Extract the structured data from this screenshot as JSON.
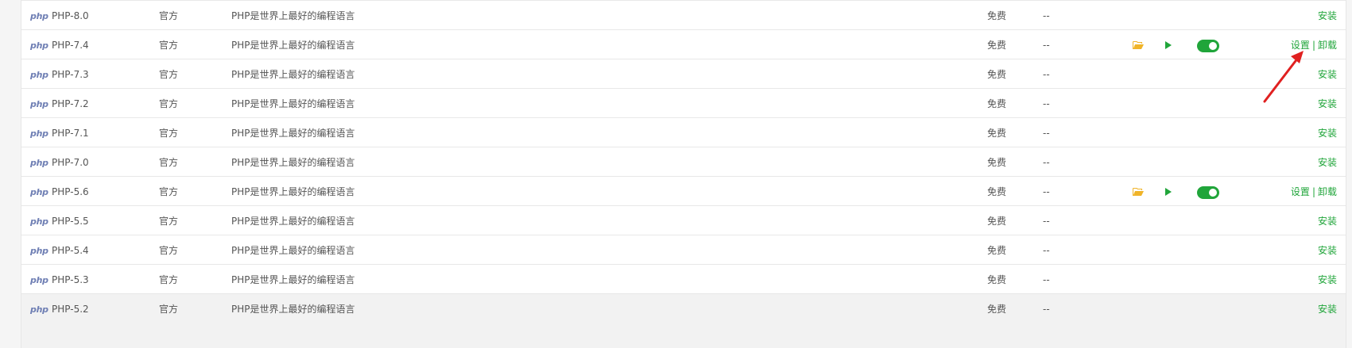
{
  "rows": [
    {
      "logo": "php",
      "name": "PHP-8.0",
      "type": "官方",
      "desc": "PHP是世界上最好的编程语言",
      "price": "免费",
      "expire": "--",
      "installed": false,
      "op_install": "安装"
    },
    {
      "logo": "php",
      "name": "PHP-7.4",
      "type": "官方",
      "desc": "PHP是世界上最好的编程语言",
      "price": "免费",
      "expire": "--",
      "installed": true,
      "op_settings": "设置",
      "op_sep": "|",
      "op_uninstall": "卸载"
    },
    {
      "logo": "php",
      "name": "PHP-7.3",
      "type": "官方",
      "desc": "PHP是世界上最好的编程语言",
      "price": "免费",
      "expire": "--",
      "installed": false,
      "op_install": "安装"
    },
    {
      "logo": "php",
      "name": "PHP-7.2",
      "type": "官方",
      "desc": "PHP是世界上最好的编程语言",
      "price": "免费",
      "expire": "--",
      "installed": false,
      "op_install": "安装"
    },
    {
      "logo": "php",
      "name": "PHP-7.1",
      "type": "官方",
      "desc": "PHP是世界上最好的编程语言",
      "price": "免费",
      "expire": "--",
      "installed": false,
      "op_install": "安装"
    },
    {
      "logo": "php",
      "name": "PHP-7.0",
      "type": "官方",
      "desc": "PHP是世界上最好的编程语言",
      "price": "免费",
      "expire": "--",
      "installed": false,
      "op_install": "安装"
    },
    {
      "logo": "php",
      "name": "PHP-5.6",
      "type": "官方",
      "desc": "PHP是世界上最好的编程语言",
      "price": "免费",
      "expire": "--",
      "installed": true,
      "op_settings": "设置",
      "op_sep": "|",
      "op_uninstall": "卸载"
    },
    {
      "logo": "php",
      "name": "PHP-5.5",
      "type": "官方",
      "desc": "PHP是世界上最好的编程语言",
      "price": "免费",
      "expire": "--",
      "installed": false,
      "op_install": "安装"
    },
    {
      "logo": "php",
      "name": "PHP-5.4",
      "type": "官方",
      "desc": "PHP是世界上最好的编程语言",
      "price": "免费",
      "expire": "--",
      "installed": false,
      "op_install": "安装"
    },
    {
      "logo": "php",
      "name": "PHP-5.3",
      "type": "官方",
      "desc": "PHP是世界上最好的编程语言",
      "price": "免费",
      "expire": "--",
      "installed": false,
      "op_install": "安装"
    },
    {
      "logo": "php",
      "name": "PHP-5.2",
      "type": "官方",
      "desc": "PHP是世界上最好的编程语言",
      "price": "免费",
      "expire": "--",
      "installed": false,
      "op_install": "安装",
      "highlighted": true
    }
  ],
  "icons": {
    "folder": "folder-open-icon",
    "play": "play-icon",
    "toggle": "toggle-on-icon",
    "annotation": "red-arrow-annotation"
  },
  "colors": {
    "accent": "#20a53a",
    "folder": "#f0b429",
    "annotation": "#e02020",
    "php_logo": "#6f7fb4"
  }
}
